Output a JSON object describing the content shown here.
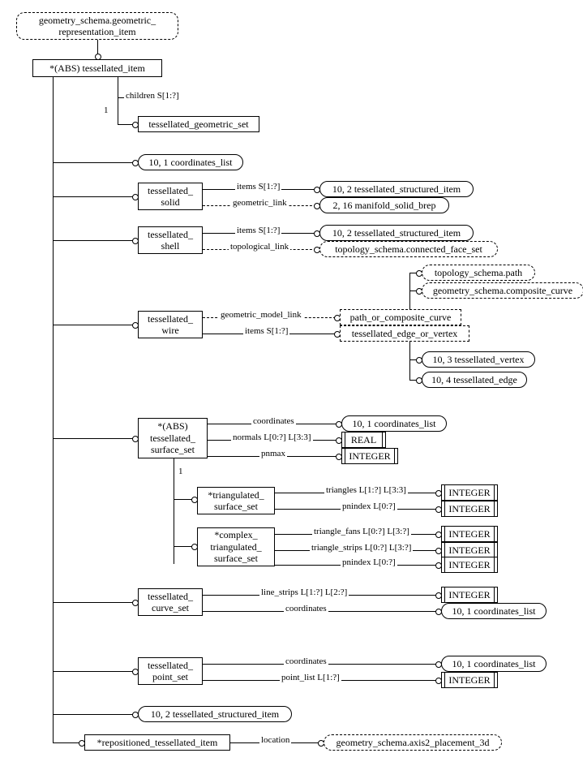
{
  "root": {
    "title": "geometry_schema.geometric_\nrepresentation_item",
    "abs_tessellated_item": "*(ABS) tessellated_item",
    "children_label": "children S[1:?]",
    "tessellated_geometric_set": "tessellated_geometric_set",
    "coordinates_list_ref": "10, 1 coordinates_list",
    "one": "1",
    "solid": {
      "name": "tessellated_\nsolid",
      "items": "items S[1:?]",
      "geometric_link": "geometric_link",
      "struct_item": "10, 2 tessellated_structured_item",
      "manifold": "2, 16 manifold_solid_brep"
    },
    "shell": {
      "name": "tessellated_\nshell",
      "items": "items S[1:?]",
      "topo_link": "topological_link",
      "struct_item": "10, 2 tessellated_structured_item",
      "face_set": "topology_schema.connected_face_set"
    },
    "wire": {
      "name": "tessellated_\nwire",
      "geom_link": "geometric_model_link",
      "items": "items S[1:?]",
      "path_or_curve": "path_or_composite_curve",
      "topo_path": "topology_schema.path",
      "composite": "geometry_schema.composite_curve",
      "edge_or_vertex": "tessellated_edge_or_vertex",
      "vertex": "10, 3 tessellated_vertex",
      "edge": "10, 4 tessellated_edge"
    },
    "surface_set": {
      "name": "*(ABS)\ntessellated_\nsurface_set",
      "coordinates": "coordinates",
      "coord_list": "10, 1 coordinates_list",
      "normals": "normals L[0:?] L[3:3]",
      "real": "REAL",
      "pnmax": "pnmax",
      "integer": "INTEGER",
      "tri": {
        "name": "*triangulated_\nsurface_set",
        "triangles": "triangles L[1:?] L[3:3]",
        "pnindex": "pnindex L[0:?]"
      },
      "complex": {
        "name": "*complex_\ntriangulated_\nsurface_set",
        "fans": "triangle_fans L[0:?] L[3:?]",
        "strips": "triangle_strips L[0:?] L[3:?]",
        "pnindex": "pnindex L[0:?]"
      }
    },
    "curve_set": {
      "name": "tessellated_\ncurve_set",
      "line_strips": "line_strips L[1:?] L[2:?]",
      "coordinates": "coordinates",
      "coord_list": "10, 1 coordinates_list"
    },
    "point_set": {
      "name": "tessellated_\npoint_set",
      "coordinates": "coordinates",
      "point_list": "point_list L[1:?]",
      "coord_list": "10, 1 coordinates_list"
    },
    "struct_item_bottom": "10, 2 tessellated_structured_item",
    "repositioned": {
      "name": "*repositioned_tessellated_item",
      "location": "location",
      "axis2": "geometry_schema.axis2_placement_3d"
    }
  }
}
